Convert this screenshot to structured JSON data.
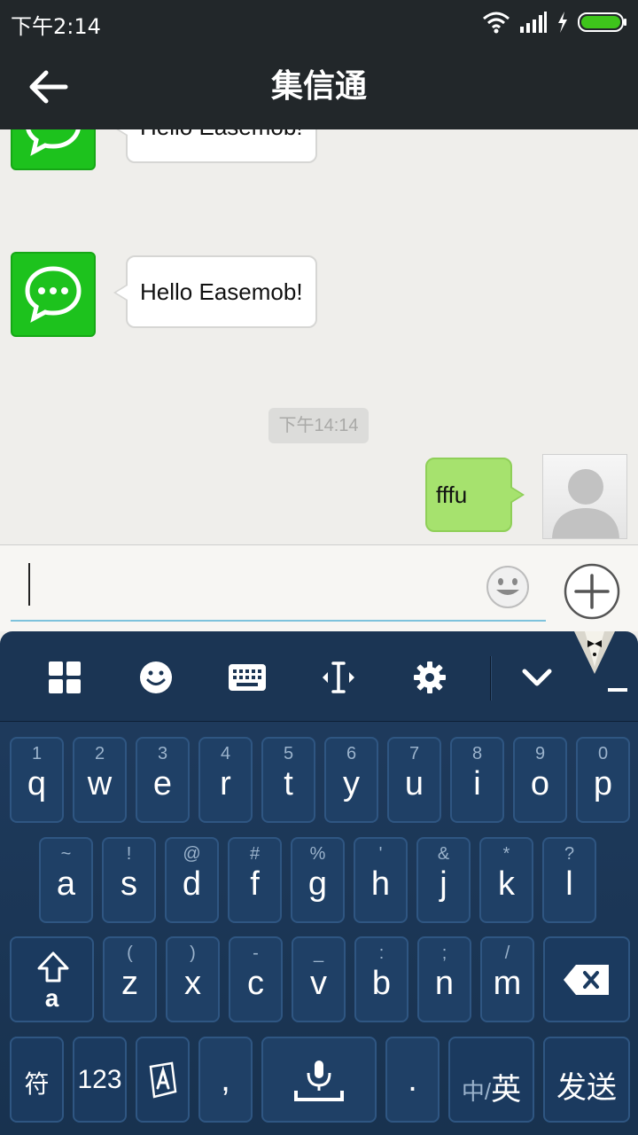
{
  "status_bar": {
    "time": "下午2:14"
  },
  "header": {
    "title": "集信通"
  },
  "messages": {
    "received_1": "Hello Easemob!",
    "received_2": "Hello Easemob!",
    "timestamp": "下午14:14",
    "sent_1": "fffu"
  },
  "composer": {
    "value": "",
    "placeholder": ""
  },
  "keyboard": {
    "row1": [
      {
        "main": "q",
        "sub": "1"
      },
      {
        "main": "w",
        "sub": "2"
      },
      {
        "main": "e",
        "sub": "3"
      },
      {
        "main": "r",
        "sub": "4"
      },
      {
        "main": "t",
        "sub": "5"
      },
      {
        "main": "y",
        "sub": "6"
      },
      {
        "main": "u",
        "sub": "7"
      },
      {
        "main": "i",
        "sub": "8"
      },
      {
        "main": "o",
        "sub": "9"
      },
      {
        "main": "p",
        "sub": "0"
      }
    ],
    "row2": [
      {
        "main": "a",
        "sub": "~"
      },
      {
        "main": "s",
        "sub": "!"
      },
      {
        "main": "d",
        "sub": "@"
      },
      {
        "main": "f",
        "sub": "#"
      },
      {
        "main": "g",
        "sub": "%"
      },
      {
        "main": "h",
        "sub": "'"
      },
      {
        "main": "j",
        "sub": "&"
      },
      {
        "main": "k",
        "sub": "*"
      },
      {
        "main": "l",
        "sub": "?"
      }
    ],
    "row3": [
      {
        "main": "z",
        "sub": "("
      },
      {
        "main": "x",
        "sub": ")"
      },
      {
        "main": "c",
        "sub": "-"
      },
      {
        "main": "v",
        "sub": "_"
      },
      {
        "main": "b",
        "sub": ":"
      },
      {
        "main": "n",
        "sub": ";"
      },
      {
        "main": "m",
        "sub": "/"
      }
    ],
    "shift_label": "a",
    "symbol_label": "符",
    "num_label": "123",
    "comma_label": ",",
    "period_label": ".",
    "lang_cn": "中/",
    "lang_en": "英",
    "send_label": "发送"
  },
  "colors": {
    "titlebar": "#22272a",
    "app_green": "#1dc21d",
    "sent_bubble": "#a6e26e",
    "keyboard_bg": "#1b3554",
    "key_bg": "#1f4066"
  },
  "icons": {
    "back": "arrow-left-icon",
    "wifi": "wifi-icon",
    "signal": "signal-icon",
    "charging": "bolt-icon",
    "battery": "battery-icon",
    "chat_app": "chat-bubble-icon",
    "user": "person-icon",
    "emoji": "smiley-icon",
    "plus": "plus-circle-icon"
  }
}
